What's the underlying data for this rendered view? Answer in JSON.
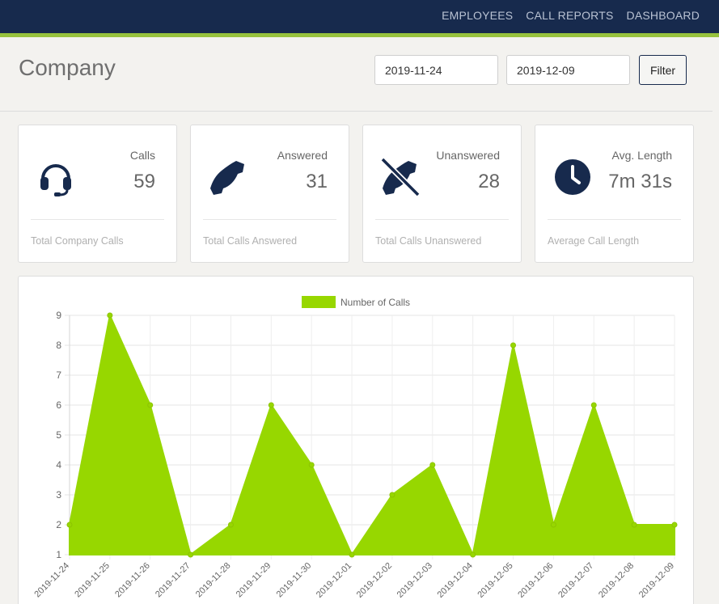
{
  "nav": {
    "items": [
      "EMPLOYEES",
      "CALL REPORTS",
      "DASHBOARD"
    ]
  },
  "page": {
    "title": "Company"
  },
  "filter": {
    "from": "2019-11-24",
    "to": "2019-12-09",
    "button_label": "Filter"
  },
  "stats": [
    {
      "label": "Calls",
      "value": "59",
      "footer": "Total Company Calls",
      "icon": "headset-icon"
    },
    {
      "label": "Answered",
      "value": "31",
      "footer": "Total Calls Answered",
      "icon": "phone-icon"
    },
    {
      "label": "Unanswered",
      "value": "28",
      "footer": "Total Calls Unanswered",
      "icon": "phone-slash-icon"
    },
    {
      "label": "Avg. Length",
      "value": "7m 31s",
      "footer": "Average Call Length",
      "icon": "clock-icon"
    }
  ],
  "colors": {
    "nav_bg": "#172a4d",
    "accent": "#97c23d",
    "series": "#97d700",
    "icon": "#172a4d"
  },
  "chart_data": {
    "type": "area",
    "x": [
      "2019-11-24",
      "2019-11-25",
      "2019-11-26",
      "2019-11-27",
      "2019-11-28",
      "2019-11-29",
      "2019-11-30",
      "2019-12-01",
      "2019-12-02",
      "2019-12-03",
      "2019-12-04",
      "2019-12-05",
      "2019-12-06",
      "2019-12-07",
      "2019-12-08",
      "2019-12-09"
    ],
    "series": [
      {
        "name": "Number of Calls",
        "values": [
          2,
          9,
          6,
          1,
          2,
          6,
          4,
          1,
          3,
          4,
          1,
          8,
          2,
          6,
          2,
          2
        ]
      }
    ],
    "ylim": [
      1,
      9
    ],
    "yticks": [
      1,
      2,
      3,
      4,
      5,
      6,
      7,
      8,
      9
    ],
    "grid": true,
    "legend": "top"
  }
}
